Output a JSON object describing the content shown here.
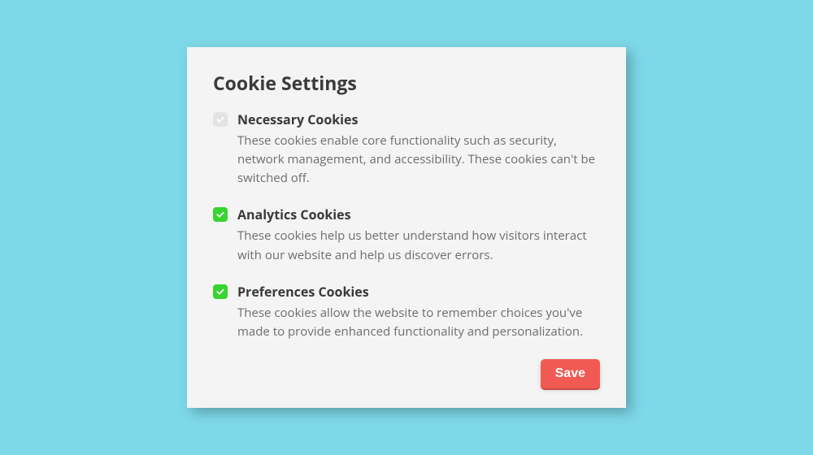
{
  "title": "Cookie Settings",
  "options": {
    "necessary": {
      "title": "Necessary Cookies",
      "desc": "These cookies enable core functionality such as security, network management, and accessibility. These cookies can't be switched off.",
      "checked": true,
      "disabled": true
    },
    "analytics": {
      "title": "Analytics Cookies",
      "desc": "These cookies help us better understand how visitors interact with our website and help us discover errors.",
      "checked": true,
      "disabled": false
    },
    "preferences": {
      "title": "Preferences Cookies",
      "desc": "These cookies allow the website to remember choices you've made to provide enhanced functionality and personalization.",
      "checked": true,
      "disabled": false
    }
  },
  "actions": {
    "save_label": "Save"
  },
  "colors": {
    "background": "#7DD8E8",
    "card": "#f4f4f4",
    "accent": "#f15a52",
    "check": "#38d430"
  }
}
